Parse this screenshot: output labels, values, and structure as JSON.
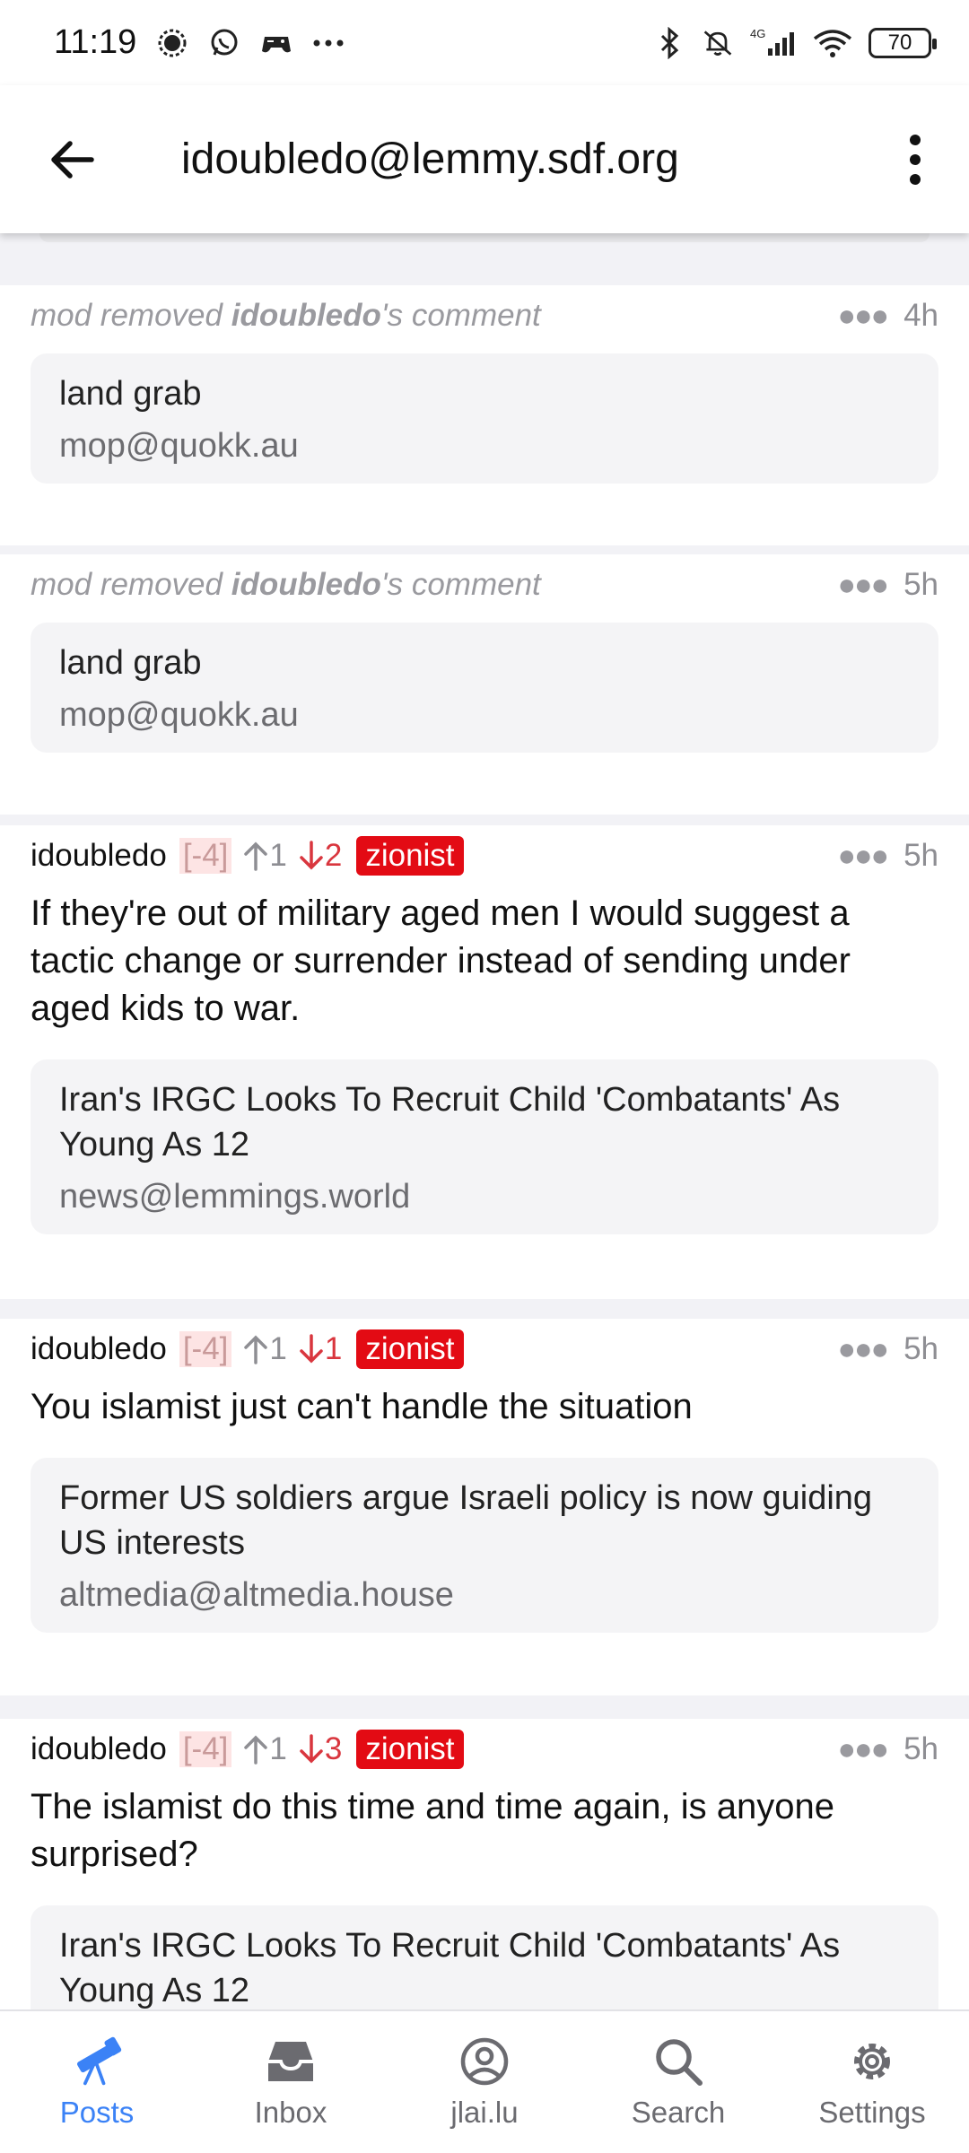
{
  "status_bar": {
    "time": "11:19",
    "battery": "70",
    "network": "4G"
  },
  "app_bar": {
    "title": "idoubledo@lemmy.sdf.org"
  },
  "feed": [
    {
      "kind": "removed",
      "removed_prefix": "mod removed ",
      "removed_user": "idoubledo",
      "removed_suffix": "'s comment",
      "time": "4h",
      "post_title": "land grab",
      "community": "mop@quokk.au"
    },
    {
      "kind": "removed",
      "removed_prefix": "mod removed ",
      "removed_user": "idoubledo",
      "removed_suffix": "'s comment",
      "time": "5h",
      "post_title": "land grab",
      "community": "mop@quokk.au"
    },
    {
      "kind": "comment",
      "user": "idoubledo",
      "score": "[-4]",
      "upvotes": "1",
      "downvotes": "2",
      "tag": "zionist",
      "time": "5h",
      "body": "If they're out of military aged men I would suggest a tactic change or surrender instead of sending under aged kids to war.",
      "post_title": "Iran's IRGC Looks To Recruit Child 'Combatants' As Young As 12",
      "community": "news@lemmings.world"
    },
    {
      "kind": "comment",
      "user": "idoubledo",
      "score": "[-4]",
      "upvotes": "1",
      "downvotes": "1",
      "tag": "zionist",
      "time": "5h",
      "body": "You islamist just can't handle the situation",
      "post_title": "Former US soldiers argue Israeli policy is now guiding US interests",
      "community": "altmedia@altmedia.house"
    },
    {
      "kind": "comment",
      "user": "idoubledo",
      "score": "[-4]",
      "upvotes": "1",
      "downvotes": "3",
      "tag": "zionist",
      "time": "5h",
      "body": "The islamist do this time and time again, is anyone surprised?",
      "post_title": "Iran's IRGC Looks To Recruit Child 'Combatants' As Young As 12"
    }
  ],
  "bottom_nav": [
    {
      "label": "Posts",
      "icon": "telescope-icon",
      "active": true
    },
    {
      "label": "Inbox",
      "icon": "inbox-icon",
      "active": false
    },
    {
      "label": "jlai.lu",
      "icon": "account-circle-icon",
      "active": false
    },
    {
      "label": "Search",
      "icon": "search-icon",
      "active": false
    },
    {
      "label": "Settings",
      "icon": "gear-icon",
      "active": false
    }
  ],
  "colors": {
    "accent": "#3b82f6",
    "tag_bg": "#e30b14",
    "downvote": "#d9363e",
    "muted": "#8e8e93"
  }
}
